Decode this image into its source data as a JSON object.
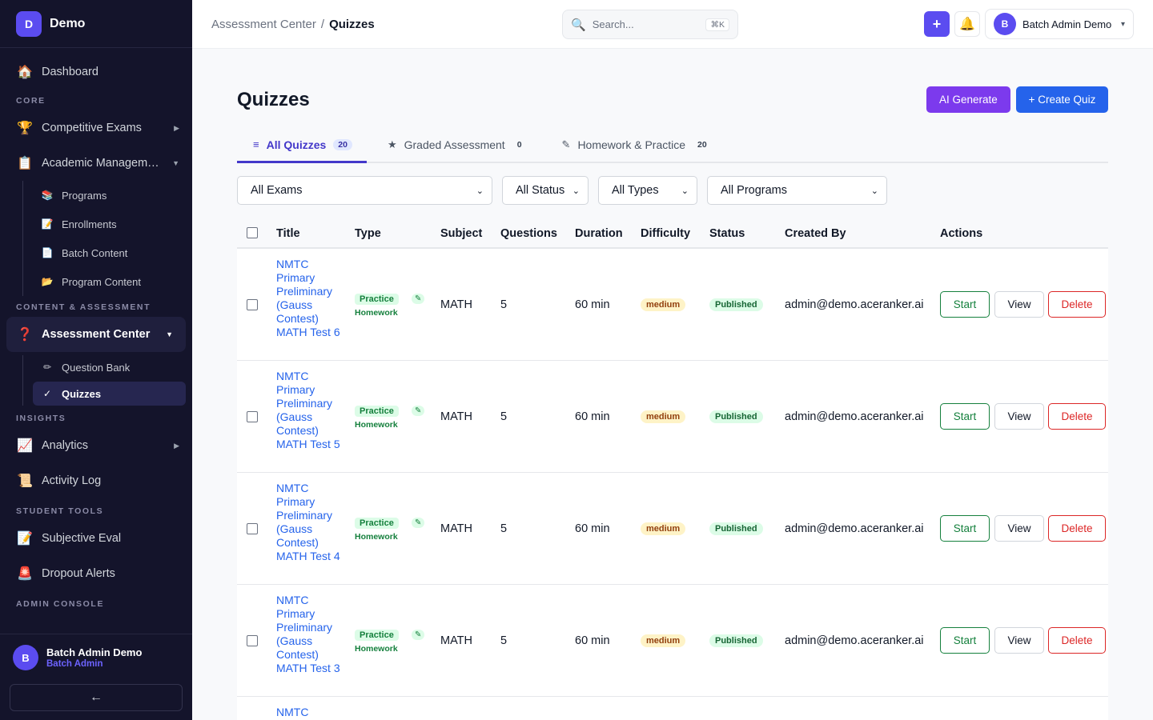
{
  "brand": {
    "logo": "D",
    "name": "Demo"
  },
  "sidebar": {
    "dashboard": "Dashboard",
    "sections": {
      "core": "CORE",
      "content": "CONTENT & ASSESSMENT",
      "insights": "INSIGHTS",
      "student_tools": "STUDENT TOOLS",
      "admin": "ADMIN CONSOLE"
    },
    "competitive_exams": "Competitive Exams",
    "academic_management": "Academic Managem…",
    "academic_sub": [
      "Programs",
      "Enrollments",
      "Batch Content",
      "Program Content"
    ],
    "assessment_center": "Assessment Center",
    "assessment_sub": [
      "Question Bank",
      "Quizzes"
    ],
    "analytics": "Analytics",
    "activity_log": "Activity Log",
    "subjective_eval": "Subjective Eval",
    "dropout_alerts": "Dropout Alerts",
    "user": {
      "initial": "B",
      "name": "Batch Admin Demo",
      "role": "Batch Admin"
    },
    "collapse_symbol": "←"
  },
  "icons": {
    "dashboard": "🏠",
    "trophy": "🏆",
    "clipboard": "📋",
    "books": "📚",
    "memo": "📝",
    "page": "📄",
    "folder": "📂",
    "question": "❓",
    "pencil": "✏",
    "check": "✓",
    "chart": "📈",
    "scroll": "📜",
    "siren": "🚨",
    "search": "🔍",
    "bell": "🔔",
    "list": "≡",
    "star": "★",
    "edit": "✎"
  },
  "topbar": {
    "breadcrumb_parent": "Assessment Center",
    "breadcrumb_sep": "/",
    "breadcrumb_current": "Quizzes",
    "search_placeholder": "Search...",
    "search_shortcut": "⌘K",
    "plus_label": "+",
    "user_initial": "B",
    "user_name": "Batch Admin Demo",
    "caret": "▾"
  },
  "page": {
    "title": "Quizzes",
    "ai_button": "AI Generate",
    "create_button": "+ Create Quiz"
  },
  "tabs": [
    {
      "label": "All Quizzes",
      "count": "20"
    },
    {
      "label": "Graded Assessment",
      "count": "0"
    },
    {
      "label": "Homework & Practice",
      "count": "20"
    }
  ],
  "filters": [
    "All Exams",
    "All Status",
    "All Types",
    "All Programs"
  ],
  "filter_caret": "⌄",
  "table": {
    "headers": [
      "Title",
      "Type",
      "Subject",
      "Questions",
      "Duration",
      "Difficulty",
      "Status",
      "Created By",
      "Actions"
    ],
    "rows": [
      {
        "title": "NMTC Primary Preliminary (Gauss Contest) MATH Test 6",
        "type": "Practice",
        "subtype": "Homework",
        "subject": "MATH",
        "questions": "5",
        "duration": "60 min",
        "difficulty": "medium",
        "status": "Published",
        "created_by": "admin@demo.aceranker.ai"
      },
      {
        "title": "NMTC Primary Preliminary (Gauss Contest) MATH Test 5",
        "type": "Practice",
        "subtype": "Homework",
        "subject": "MATH",
        "questions": "5",
        "duration": "60 min",
        "difficulty": "medium",
        "status": "Published",
        "created_by": "admin@demo.aceranker.ai"
      },
      {
        "title": "NMTC Primary Preliminary (Gauss Contest) MATH Test 4",
        "type": "Practice",
        "subtype": "Homework",
        "subject": "MATH",
        "questions": "5",
        "duration": "60 min",
        "difficulty": "medium",
        "status": "Published",
        "created_by": "admin@demo.aceranker.ai"
      },
      {
        "title": "NMTC Primary Preliminary (Gauss Contest) MATH Test 3",
        "type": "Practice",
        "subtype": "Homework",
        "subject": "MATH",
        "questions": "5",
        "duration": "60 min",
        "difficulty": "medium",
        "status": "Published",
        "created_by": "admin@demo.aceranker.ai"
      }
    ],
    "partial_row_title": "NMTC",
    "actions": {
      "start": "Start",
      "view": "View",
      "delete": "Delete"
    }
  }
}
